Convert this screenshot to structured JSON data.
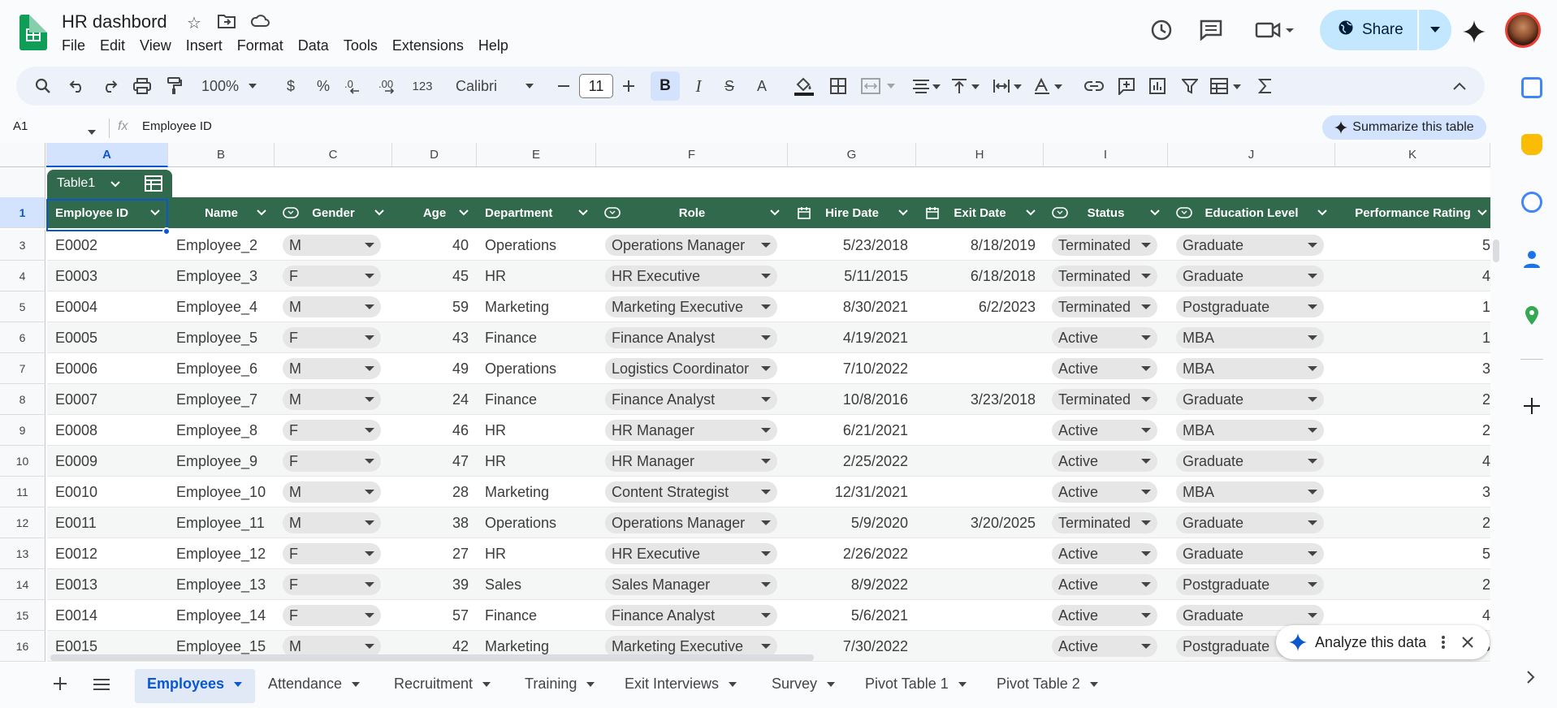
{
  "doc": {
    "title": "HR dashbord"
  },
  "menu": [
    "File",
    "Edit",
    "View",
    "Insert",
    "Format",
    "Data",
    "Tools",
    "Extensions",
    "Help"
  ],
  "share": {
    "label": "Share"
  },
  "toolbar": {
    "zoom": "100%",
    "currency": "$",
    "percent": "%",
    "dec_less": ".0",
    "dec_more": ".00",
    "number_format": "123",
    "font": "Calibri",
    "font_size": "11",
    "bold": "B",
    "italic": "I",
    "strike": "S",
    "text_color": "A"
  },
  "formula": {
    "cell_ref": "A1",
    "fx": "fx",
    "content": "Employee ID"
  },
  "summarize": {
    "label": "Summarize this table"
  },
  "columns": [
    "A",
    "B",
    "C",
    "D",
    "E",
    "F",
    "G",
    "H",
    "I",
    "J",
    "K"
  ],
  "table": {
    "name": "Table1"
  },
  "headers": [
    "Employee ID",
    "Name",
    "Gender",
    "Age",
    "Department",
    "Role",
    "Hire Date",
    "Exit Date",
    "Status",
    "Education Level",
    "Performance Rating"
  ],
  "row_numbers": [
    "1",
    "3",
    "4",
    "5",
    "6",
    "7",
    "8",
    "9",
    "10",
    "11",
    "12",
    "13",
    "14",
    "15",
    "16"
  ],
  "rows": [
    {
      "id": "E0002",
      "name": "Employee_2",
      "gender": "M",
      "age": "40",
      "dept": "Operations",
      "role": "Operations Manager",
      "hire": "5/23/2018",
      "exit": "8/18/2019",
      "status": "Terminated",
      "edu": "Graduate",
      "perf": "5"
    },
    {
      "id": "E0003",
      "name": "Employee_3",
      "gender": "F",
      "age": "45",
      "dept": "HR",
      "role": "HR Executive",
      "hire": "5/11/2015",
      "exit": "6/18/2018",
      "status": "Terminated",
      "edu": "Graduate",
      "perf": "4"
    },
    {
      "id": "E0004",
      "name": "Employee_4",
      "gender": "M",
      "age": "59",
      "dept": "Marketing",
      "role": "Marketing Executive",
      "hire": "8/30/2021",
      "exit": "6/2/2023",
      "status": "Terminated",
      "edu": "Postgraduate",
      "perf": "1"
    },
    {
      "id": "E0005",
      "name": "Employee_5",
      "gender": "F",
      "age": "43",
      "dept": "Finance",
      "role": "Finance Analyst",
      "hire": "4/19/2021",
      "exit": "",
      "status": "Active",
      "edu": "MBA",
      "perf": "1"
    },
    {
      "id": "E0006",
      "name": "Employee_6",
      "gender": "M",
      "age": "49",
      "dept": "Operations",
      "role": "Logistics Coordinator",
      "hire": "7/10/2022",
      "exit": "",
      "status": "Active",
      "edu": "MBA",
      "perf": "3"
    },
    {
      "id": "E0007",
      "name": "Employee_7",
      "gender": "M",
      "age": "24",
      "dept": "Finance",
      "role": "Finance Analyst",
      "hire": "10/8/2016",
      "exit": "3/23/2018",
      "status": "Terminated",
      "edu": "Graduate",
      "perf": "2"
    },
    {
      "id": "E0008",
      "name": "Employee_8",
      "gender": "F",
      "age": "46",
      "dept": "HR",
      "role": "HR Manager",
      "hire": "6/21/2021",
      "exit": "",
      "status": "Active",
      "edu": "MBA",
      "perf": "2"
    },
    {
      "id": "E0009",
      "name": "Employee_9",
      "gender": "F",
      "age": "47",
      "dept": "HR",
      "role": "HR Manager",
      "hire": "2/25/2022",
      "exit": "",
      "status": "Active",
      "edu": "Graduate",
      "perf": "4"
    },
    {
      "id": "E0010",
      "name": "Employee_10",
      "gender": "M",
      "age": "28",
      "dept": "Marketing",
      "role": "Content Strategist",
      "hire": "12/31/2021",
      "exit": "",
      "status": "Active",
      "edu": "MBA",
      "perf": "3"
    },
    {
      "id": "E0011",
      "name": "Employee_11",
      "gender": "M",
      "age": "38",
      "dept": "Operations",
      "role": "Operations Manager",
      "hire": "5/9/2020",
      "exit": "3/20/2025",
      "status": "Terminated",
      "edu": "Graduate",
      "perf": "2"
    },
    {
      "id": "E0012",
      "name": "Employee_12",
      "gender": "F",
      "age": "27",
      "dept": "HR",
      "role": "HR Executive",
      "hire": "2/26/2022",
      "exit": "",
      "status": "Active",
      "edu": "Graduate",
      "perf": "5"
    },
    {
      "id": "E0013",
      "name": "Employee_13",
      "gender": "F",
      "age": "39",
      "dept": "Sales",
      "role": "Sales Manager",
      "hire": "8/9/2022",
      "exit": "",
      "status": "Active",
      "edu": "Postgraduate",
      "perf": "2"
    },
    {
      "id": "E0014",
      "name": "Employee_14",
      "gender": "F",
      "age": "57",
      "dept": "Finance",
      "role": "Finance Analyst",
      "hire": "5/6/2021",
      "exit": "",
      "status": "Active",
      "edu": "Graduate",
      "perf": "4"
    },
    {
      "id": "E0015",
      "name": "Employee_15",
      "gender": "M",
      "age": "42",
      "dept": "Marketing",
      "role": "Marketing Executive",
      "hire": "7/30/2022",
      "exit": "",
      "status": "Active",
      "edu": "Postgraduate",
      "perf": "3"
    }
  ],
  "sheet_tabs": [
    "Employees",
    "Attendance",
    "Recruitment",
    "Training",
    "Exit Interviews",
    "Survey",
    "Pivot Table 1",
    "Pivot Table 2"
  ],
  "analyze": {
    "label": "Analyze this data"
  },
  "colors": {
    "table_header": "#30694b",
    "share_bg": "#c2e7ff",
    "accent": "#0b57d0"
  }
}
